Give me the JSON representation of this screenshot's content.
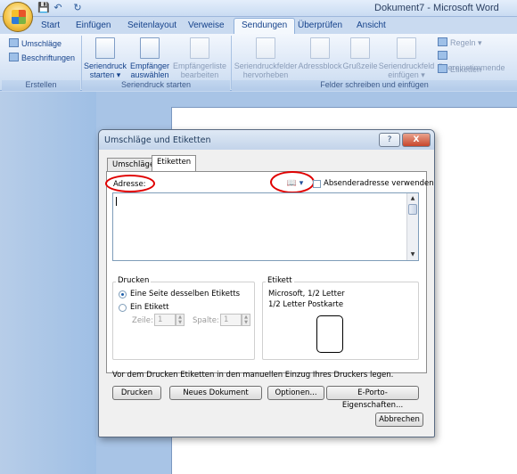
{
  "window": {
    "title": "Dokument7 - Microsoft Word"
  },
  "quick_access": [
    "save-icon",
    "undo-icon",
    "redo-icon"
  ],
  "tabs": [
    "Start",
    "Einfügen",
    "Seitenlayout",
    "Verweise",
    "Sendungen",
    "Überprüfen",
    "Ansicht"
  ],
  "ribbon": {
    "erstellen": {
      "label": "Erstellen",
      "umschlaege": "Umschläge",
      "beschriftungen": "Beschriftungen"
    },
    "seriendruck": {
      "label": "Seriendruck starten",
      "seriendruck_starten": [
        "Seriendruck",
        "starten ▾"
      ],
      "empfaenger": [
        "Empfänger",
        "auswählen ▾"
      ],
      "empfaengerliste": [
        "Empfängerliste",
        "bearbeiten"
      ]
    },
    "felder": {
      "label": "Felder schreiben und einfügen",
      "hervorheben": [
        "Seriendruckfelder",
        "hervorheben"
      ],
      "adressblock": "Adressblock",
      "grusszeile": "Grußzeile",
      "einfuegen": [
        "Seriendruckfeld",
        "einfügen ▾"
      ],
      "regeln": "Regeln ▾",
      "uebereinstimmende": "Übereinstimmende",
      "aktualisieren": "Etiketten aktualisier"
    }
  },
  "dialog": {
    "title": "Umschläge und Etiketten",
    "help": "?",
    "close": "X",
    "tabs": [
      "Umschläge",
      "Etiketten"
    ],
    "active_tab": "Etiketten",
    "adresse_label": "Adresse:",
    "absender_label": "Absenderadresse verwenden",
    "adresse_value": "",
    "drucken_group": {
      "label": "Drucken",
      "option1": "Eine Seite desselben Etiketts",
      "option2": "Ein Etikett",
      "zeile_label": "Zeile:",
      "zeile_value": "1",
      "spalte_label": "Spalte:",
      "spalte_value": "1"
    },
    "etikett_group": {
      "label": "Etikett",
      "line1": "Microsoft, 1/2 Letter",
      "line2": "1/2 Letter Postkarte"
    },
    "hint": "Vor dem Drucken Etiketten in den manuellen Einzug Ihres Druckers legen.",
    "buttons": {
      "drucken": "Drucken",
      "neues_dokument": "Neues Dokument",
      "optionen": "Optionen...",
      "eporto": "E-Porto-Eigenschaften...",
      "abbrechen": "Abbrechen"
    }
  },
  "annotation_color": "#e00000"
}
